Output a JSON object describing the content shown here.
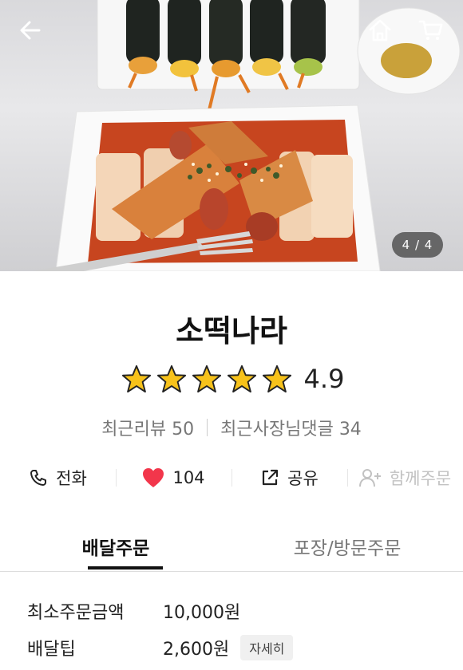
{
  "store": {
    "name": "소떡나라",
    "rating": "4.9",
    "stars": 5,
    "recent_reviews_label": "최근리뷰 50",
    "owner_replies_label": "최근사장님댓글 34"
  },
  "gallery": {
    "counter": "4 / 4"
  },
  "actions": {
    "call": "전화",
    "likes": "104",
    "share": "공유",
    "group_order": "함께주문"
  },
  "tabs": [
    {
      "label": "배달주문",
      "active": true
    },
    {
      "label": "포장/방문주문",
      "active": false
    }
  ],
  "info": {
    "min_order_label": "최소주문금액",
    "min_order_value": "10,000원",
    "delivery_tip_label": "배달팁",
    "delivery_tip_value": "2,600원",
    "detail_button": "자세히"
  },
  "colors": {
    "star": "#f7c21a",
    "heart": "#f2364b",
    "accent": "#111111"
  },
  "icons": [
    "back-arrow-icon",
    "home-icon",
    "cart-icon",
    "phone-icon",
    "heart-icon",
    "share-icon",
    "add-person-icon",
    "star-icon"
  ]
}
